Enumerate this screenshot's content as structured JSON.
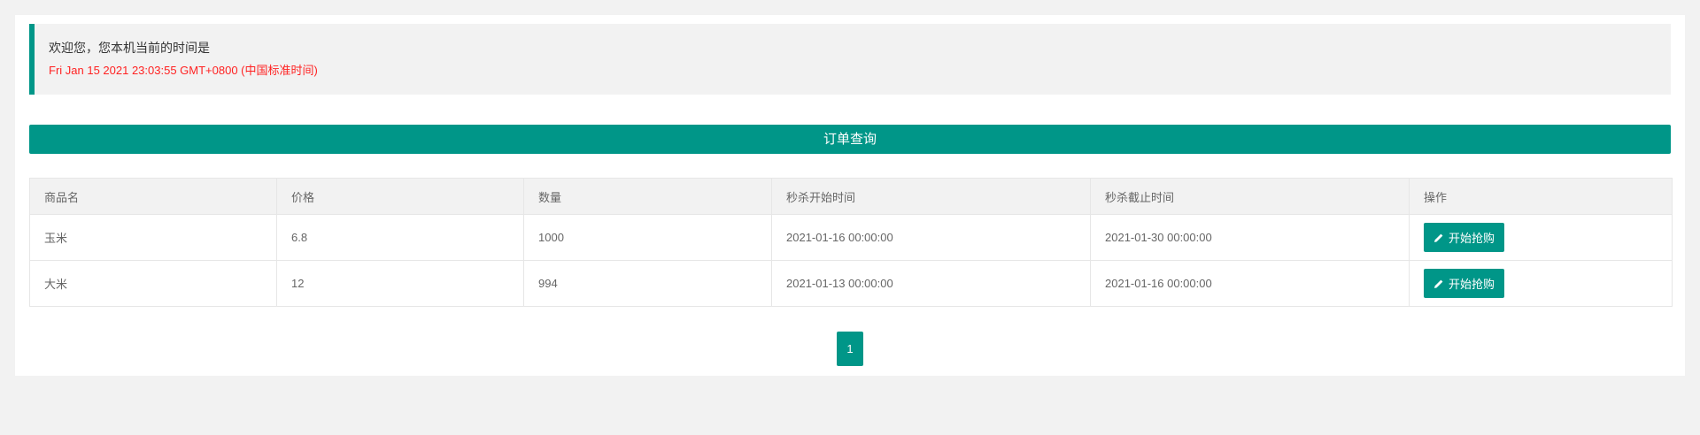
{
  "notice": {
    "title": "欢迎您，您本机当前的时间是",
    "time": "Fri Jan 15 2021 23:03:55 GMT+0800 (中国标准时间)"
  },
  "query_button": "订单查询",
  "table": {
    "headers": [
      "商品名",
      "价格",
      "数量",
      "秒杀开始时间",
      "秒杀截止时间",
      "操作"
    ],
    "rows": [
      {
        "name": "玉米",
        "price": "6.8",
        "qty": "1000",
        "start": "2021-01-16 00:00:00",
        "end": "2021-01-30 00:00:00",
        "action": "开始抢购"
      },
      {
        "name": "大米",
        "price": "12",
        "qty": "994",
        "start": "2021-01-13 00:00:00",
        "end": "2021-01-16 00:00:00",
        "action": "开始抢购"
      }
    ]
  },
  "pagination": {
    "current": "1"
  },
  "colors": {
    "accent": "#009688",
    "time_text": "#ff2222"
  },
  "icons": {
    "action_icon": "pencil-icon"
  }
}
